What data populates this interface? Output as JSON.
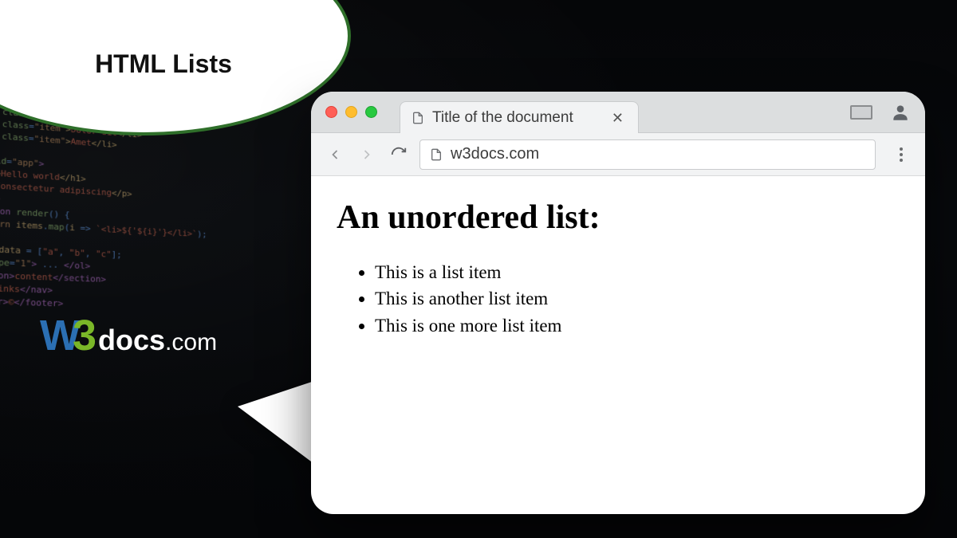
{
  "badge": {
    "title": "HTML Lists"
  },
  "logo": {
    "w": "W",
    "three": "3",
    "rest": "docs",
    "dotcom": ".com"
  },
  "browser": {
    "tab": {
      "label": "Title of the document"
    },
    "omnibox": {
      "url": "w3docs.com"
    }
  },
  "page": {
    "heading": "An unordered list:",
    "items": [
      "This is a list item",
      "This is another list item",
      "This is one more list item"
    ]
  }
}
